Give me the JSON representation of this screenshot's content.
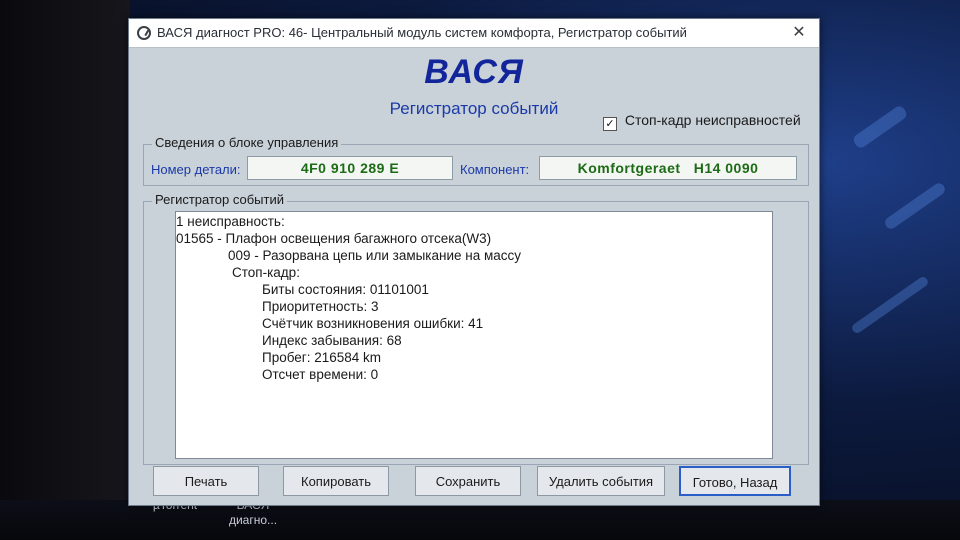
{
  "taskbar": {
    "item1_label": "µTorrent",
    "item2_label_line1": "ВАСЯ",
    "item2_label_line2": "диагно..."
  },
  "window": {
    "title": "ВАСЯ диагност PRO: 46- Центральный модуль систем комфорта,  Регистратор событий",
    "close_glyph": "✕"
  },
  "header": {
    "brand": "ВАСЯ",
    "subtitle": "Регистратор событий",
    "stopframe_label": "Стоп-кадр неисправностей",
    "stopframe_checked": true,
    "check_glyph": "✓"
  },
  "module_info": {
    "group_title": "Сведения о блоке управления",
    "part_number_label": "Номер детали:",
    "part_number_value": "4F0 910 289 E",
    "component_label": "Компонент:",
    "component_value": "Komfortgeraet   H14 0090"
  },
  "event_log": {
    "group_title": "Регистратор событий",
    "lines": [
      "1 неисправность:",
      "01565 - Плафон освещения багажного отсека(W3)",
      "009 - Разорвана цепь или замыкание на массу",
      "Стоп-кадр:",
      "Биты состояния: 01101001",
      "Приоритетность: 3",
      "Счётчик возникновения ошибки: 41",
      "Индекс забывания: 68",
      "Пробег: 216584 km",
      "Отсчет времени: 0"
    ]
  },
  "buttons": {
    "print": "Печать",
    "copy": "Копировать",
    "save": "Сохранить",
    "delete_events": "Удалить события",
    "done_back": "Готово, Назад"
  },
  "colors": {
    "brand": "#12259a",
    "label_blue": "#1b3aa8",
    "value_green": "#1d6b16",
    "window_bg": "#c9d1d9"
  }
}
